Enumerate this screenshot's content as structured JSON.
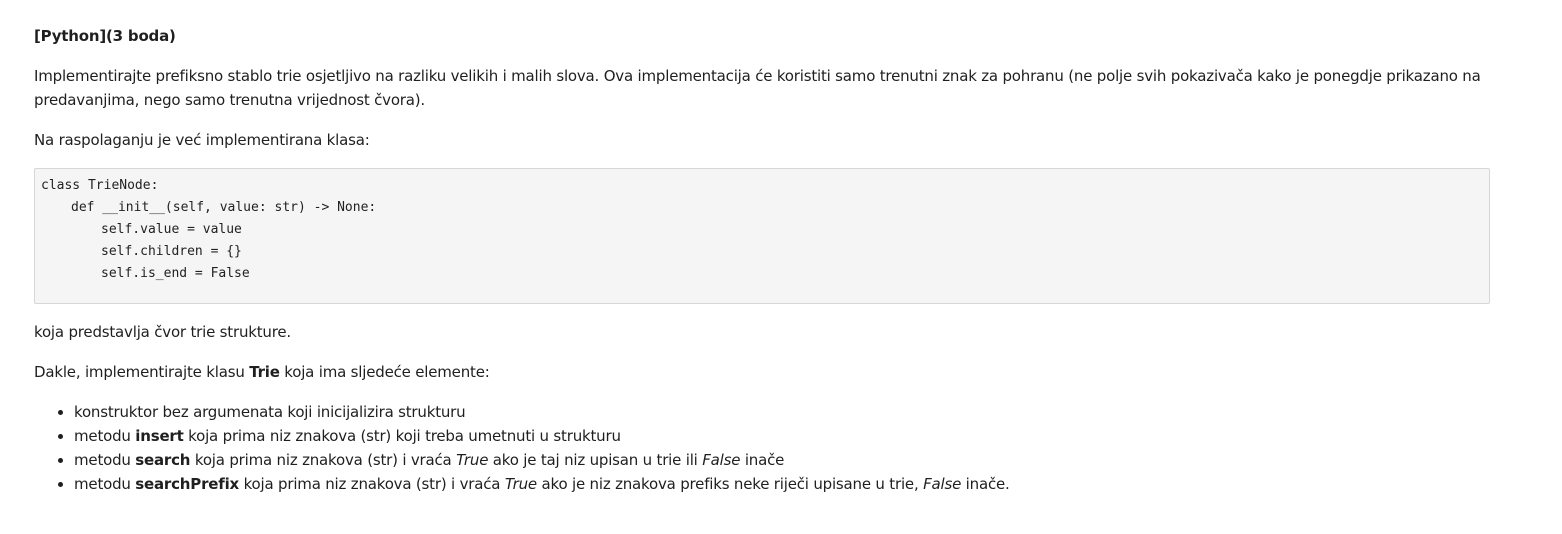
{
  "heading": {
    "language": "[Python]",
    "points": "(3 boda)"
  },
  "intro": {
    "text": "Implementirajte prefiksno stablo trie osjetljivo na razliku velikih i malih slova. Ova implementacija će koristiti samo trenutni znak za pohranu (ne polje svih pokazivača kako je ponegdje prikazano na predavanjima, nego samo trenutna vrijednost čvora)."
  },
  "available_class": {
    "text": "Na raspolaganju je već implementirana klasa:"
  },
  "code": {
    "lines": [
      "class TrieNode:",
      "def __init__(self, value: str) -> None:",
      "self.value = value",
      "self.children = {}",
      "self.is_end = False"
    ]
  },
  "after_code": {
    "text": "koja predstavlja čvor trie strukture."
  },
  "task": {
    "prefix": "Dakle, implementirajte klasu ",
    "class_name": "Trie",
    "suffix": " koja ima sljedeće elemente:"
  },
  "items": [
    {
      "text": "konstruktor bez argumenata koji inicijalizira strukturu"
    },
    {
      "prefix": "metodu ",
      "method": "insert",
      "text": " koja prima niz znakova (str) koji treba umetnuti u strukturu"
    },
    {
      "prefix": "metodu ",
      "method": "search",
      "text1": " koja prima niz znakova (str) i vraća ",
      "true_word": "True",
      "text2": " ako je taj niz upisan u trie ili ",
      "false_word": "False",
      "text3": " inače"
    },
    {
      "prefix": "metodu ",
      "method": "searchPrefix",
      "text1": " koja prima niz znakova (str) i vraća ",
      "true_word": "True",
      "text2": " ako je niz znakova prefiks neke riječi upisane u trie, ",
      "false_word": "False",
      "text3": " inače."
    }
  ]
}
